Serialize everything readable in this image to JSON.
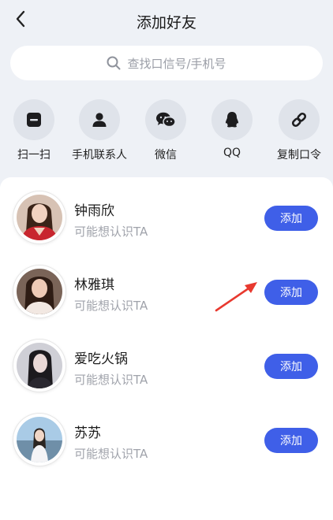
{
  "header": {
    "title": "添加好友",
    "back_icon": "chevron-left-icon"
  },
  "search": {
    "placeholder": "查找口信号/手机号",
    "icon": "search-icon"
  },
  "quick_actions": [
    {
      "label": "扫一扫",
      "icon": "scan-icon"
    },
    {
      "label": "手机联系人",
      "icon": "contact-icon"
    },
    {
      "label": "微信",
      "icon": "wechat-icon"
    },
    {
      "label": "QQ",
      "icon": "qq-icon"
    },
    {
      "label": "复制口令",
      "icon": "link-icon"
    }
  ],
  "suggestions": [
    {
      "name": "钟雨欣",
      "subtitle": "可能想认识TA",
      "button": "添加"
    },
    {
      "name": "林雅琪",
      "subtitle": "可能想认识TA",
      "button": "添加"
    },
    {
      "name": "爱吃火锅",
      "subtitle": "可能想认识TA",
      "button": "添加"
    },
    {
      "name": "苏苏",
      "subtitle": "可能想认识TA",
      "button": "添加"
    }
  ],
  "colors": {
    "accent": "#3f5fe8",
    "annotation_arrow": "#e8392f",
    "background": "#eef1f6"
  }
}
